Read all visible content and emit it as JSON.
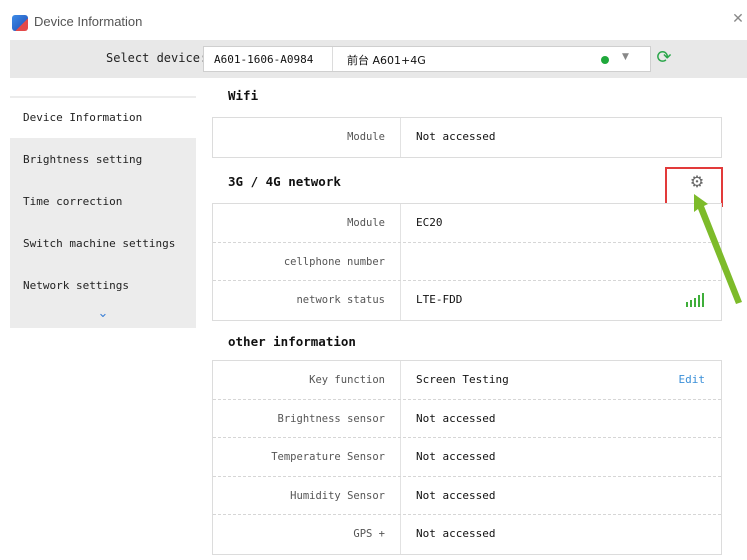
{
  "window": {
    "title": "Device Information"
  },
  "device_bar": {
    "label": "Select device:",
    "device_id": "A601-1606-A0984",
    "device_name": "前台 A601+4G",
    "status_color": "#1fa83b"
  },
  "sidebar": {
    "items": [
      {
        "label": "Device Information",
        "active": true
      },
      {
        "label": "Brightness setting"
      },
      {
        "label": "Time correction"
      },
      {
        "label": "Switch machine settings"
      },
      {
        "label": "Network settings"
      }
    ],
    "more_icon": "chevron-down-icon"
  },
  "sections": {
    "wifi": {
      "title": "Wifi",
      "rows": [
        {
          "label": "Module",
          "value": "Not accessed"
        }
      ]
    },
    "network": {
      "title": "3G / 4G network",
      "settings_icon": "gear-icon",
      "rows": [
        {
          "label": "Module",
          "value": "EC20"
        },
        {
          "label": "cellphone number",
          "value": ""
        },
        {
          "label": "network status",
          "value": "LTE-FDD"
        }
      ]
    },
    "other": {
      "title": "other information",
      "rows": [
        {
          "label": "Key function",
          "value": "Screen Testing",
          "action": "Edit"
        },
        {
          "label": "Brightness sensor",
          "value": "Not accessed"
        },
        {
          "label": "Temperature Sensor",
          "value": "Not accessed"
        },
        {
          "label": "Humidity Sensor",
          "value": "Not accessed"
        },
        {
          "label": "GPS +",
          "value": "Not accessed"
        }
      ]
    }
  },
  "colors": {
    "accent": "#3a8fd8",
    "highlight": "#e23a3a",
    "signal": "#3fae3a",
    "arrow": "#7dbb2a"
  }
}
